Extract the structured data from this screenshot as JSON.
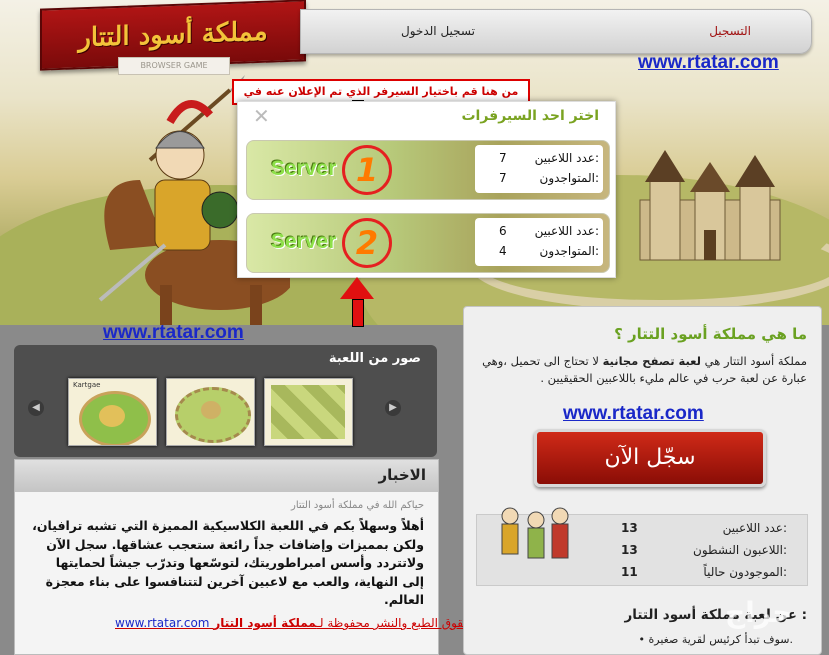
{
  "logo": {
    "title": "مملكة أسود التتار",
    "subtitle": "BROWSER GAME"
  },
  "nav": {
    "register": "التسجيل",
    "login": "تسجيل الدخول"
  },
  "watermark_url": "www.rtatar.com",
  "annotation": "من هنا قم باختيار السيرفر الذي تم الإعلان عنه في الإعلان",
  "popup": {
    "title": "اختر احد السيرفرات",
    "close": "✕",
    "servers": [
      {
        "name": "Server",
        "number": "1",
        "players_label": "عدد اللاعبين:",
        "players": "7",
        "online_label": "المتواجدون:",
        "online": "7"
      },
      {
        "name": "Server",
        "number": "2",
        "players_label": "عدد اللاعبين:",
        "players": "6",
        "online_label": "المتواجدون:",
        "online": "4"
      }
    ]
  },
  "gallery": {
    "title": "صور من اللعبة",
    "prev": "◀",
    "next": "▶",
    "thumb_caption": "Kartgae"
  },
  "news": {
    "title": "الاخبار",
    "subtitle": "حياكم الله في مملكة أسود التتار",
    "body": "أهلاً وسهلاً بكم في اللعبة الكلاسيكية المميزة التي تشبه ترافيان، ولكن بمميزات وإضافات جداً رائعة ستعجب عشاقها. سجل الآن ولاتتردد وأسس امبراطوريتك، لتوسّعها وتدرّب جيشاً لحمايتها إلى النهاية، والعب مع لاعبين آخرين لتتنافسوا على بناء معجزة العالم.",
    "copyright_prefix": "جميع حقوق الطبع والنشر محفوظة لـ",
    "copyright_name": "مملكة أسود التتار",
    "copyright_link": "www.rtatar.com"
  },
  "about": {
    "title": "ما هي مملكة أسود التتار ؟",
    "text_1": "مملكة أسود التتار هي ",
    "text_bold": "لعبة تصفح مجانية",
    "text_2": " لا تحتاج الى تحميل ،وهي عبارة عن لعبة حرب في عالم مليء باللاعبين الحقيقيين .",
    "register_button": "سجّل الآن",
    "stats": [
      {
        "label": "عدد اللاعبين:",
        "value": "13"
      },
      {
        "label": "اللاعبون النشطون:",
        "value": "13"
      },
      {
        "label": "الموجودون حالياً:",
        "value": "11"
      }
    ],
    "section_title": "عن لعبة مملكة أسود التتار :",
    "bullet": "سوف تبدأ كرئيس لقرية صغيرة."
  },
  "corner_mark": "حراج"
}
